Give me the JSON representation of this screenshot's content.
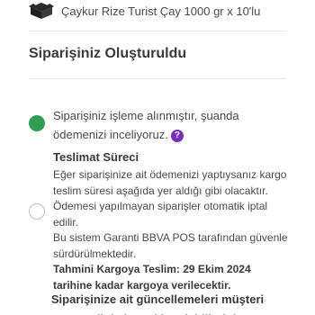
{
  "product": {
    "icon": "tea-box-icon",
    "name": "Çaykur Rize Turist Çay 1000 gr x 10'lu"
  },
  "order": {
    "title": "Siparişiniz Oluşturuldu"
  },
  "steps": {
    "active": {
      "text": "Siparişiniz işleme alınmıştır, şuanda ödemenizi inceliyoruz.",
      "help_icon": "question-icon",
      "color": "#2e9e55"
    },
    "shipping": {
      "title": "Teslimat Süreci",
      "line1": "Eğer siparişinize ait ödemenizi yaptıysanız kargo teslim süresi aşağıda yer aldığı gibi olacaktır.",
      "line2": "Ödemesi yapılmayan siparişler otomatik iptal edilir.",
      "line3": "Bu sistem Garanti BBVA POS tarafından güvenle sürdürülmektedir.",
      "estimate": "Tahmini Kargoya Teslim: 29 Ekim 2024 tarihine kadar kargoya verilecektir."
    }
  },
  "followup": {
    "text": "Siparişinize ait güncellemeleri müşteri panelinizden takip edebilirsiniz."
  },
  "colors": {
    "accent": "#7b2fb8",
    "success": "#2e9e55"
  }
}
